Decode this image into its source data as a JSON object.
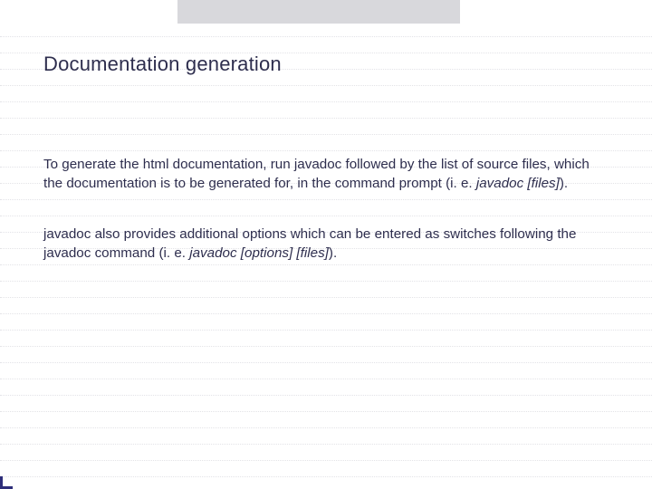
{
  "title": "Documentation generation",
  "para1": {
    "t1": "To generate the html documentation, run javadoc followed by the list of source files, which the documentation is to be generated for, in the command prompt (i. e. ",
    "cmd": "javadoc [files]",
    "t2": ")."
  },
  "para2": {
    "t1": "javadoc also provides additional options which can be entered as switches following the javadoc command (i. e. ",
    "cmd": "javadoc [options] [files]",
    "t2": ")."
  }
}
